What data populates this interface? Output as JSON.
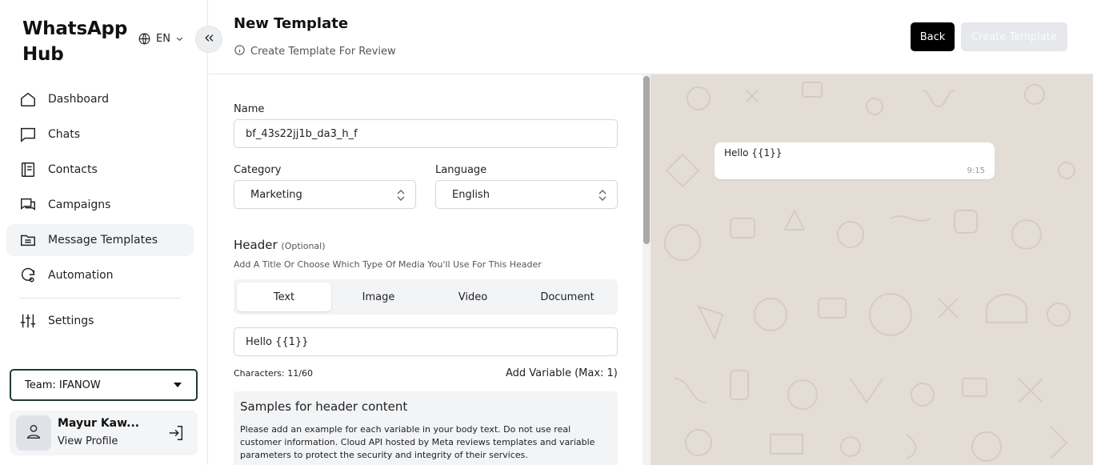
{
  "sidebar": {
    "brand": "WhatsApp Hub",
    "language": "EN",
    "nav": [
      {
        "label": "Dashboard",
        "icon": "home-icon"
      },
      {
        "label": "Chats",
        "icon": "chat-icon"
      },
      {
        "label": "Contacts",
        "icon": "contacts-icon"
      },
      {
        "label": "Campaigns",
        "icon": "campaigns-icon"
      },
      {
        "label": "Message Templates",
        "icon": "templates-icon",
        "active": true
      },
      {
        "label": "Automation",
        "icon": "automation-icon"
      }
    ],
    "settings_label": "Settings",
    "team_label": "Team: IFANOW",
    "profile": {
      "name": "Mayur Kaw...",
      "link": "View Profile"
    }
  },
  "header": {
    "title": "New Template",
    "subtitle": "Create Template For Review",
    "back_label": "Back",
    "create_label": "Create Template"
  },
  "form": {
    "name_label": "Name",
    "name_value": "bf_43s22jj1b_da3_h_f",
    "category_label": "Category",
    "category_value": "Marketing",
    "language_label": "Language",
    "language_value": "English",
    "header_title": "Header",
    "header_optional": "(Optional)",
    "header_hint": "Add A Title Or Choose Which Type Of Media You'll Use For This Header",
    "tabs": [
      "Text",
      "Image",
      "Video",
      "Document"
    ],
    "active_tab": "Text",
    "header_text_value": "Hello {{1}}",
    "characters": "Characters: 11/60",
    "add_variable": "Add Variable (Max: 1)",
    "samples_title": "Samples for header content",
    "samples_text": "Please add an example for each variable in your body text. Do not use real customer information. Cloud API hosted by Meta reviews templates and variable parameters to protect the security and integrity of their services."
  },
  "preview": {
    "message": "Hello {{1}}",
    "time": "9:15"
  },
  "colors": {
    "primary_button": "#000000",
    "disabled_button": "#e6e8eb",
    "team_border": "#1f3b34",
    "chat_background": "#e4ddd6"
  }
}
